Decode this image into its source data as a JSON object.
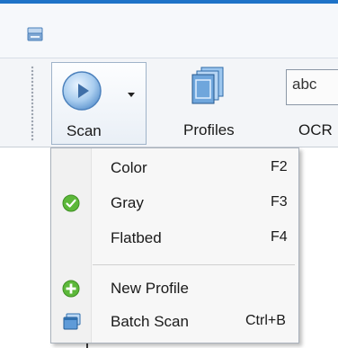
{
  "window": {
    "icon": "scanner-icon"
  },
  "ribbon": {
    "scan": {
      "label": "Scan",
      "icon": "play-icon",
      "dropdown_icon": "chevron-down-icon"
    },
    "profiles": {
      "label": "Profiles",
      "icon": "profiles-icon"
    },
    "ocr": {
      "label": "OCR",
      "icon_text": "abc",
      "icon": "ocr-icon"
    }
  },
  "menu": {
    "items": [
      {
        "label": "Color",
        "shortcut": "F2",
        "checked": false
      },
      {
        "label": "Gray",
        "shortcut": "F3",
        "checked": true
      },
      {
        "label": "Flatbed",
        "shortcut": "F4",
        "checked": false
      },
      {
        "label": "New Profile",
        "shortcut": "",
        "icon": "plus-icon"
      },
      {
        "label": "Batch Scan",
        "shortcut": "Ctrl+B",
        "icon": "batch-icon"
      }
    ]
  }
}
